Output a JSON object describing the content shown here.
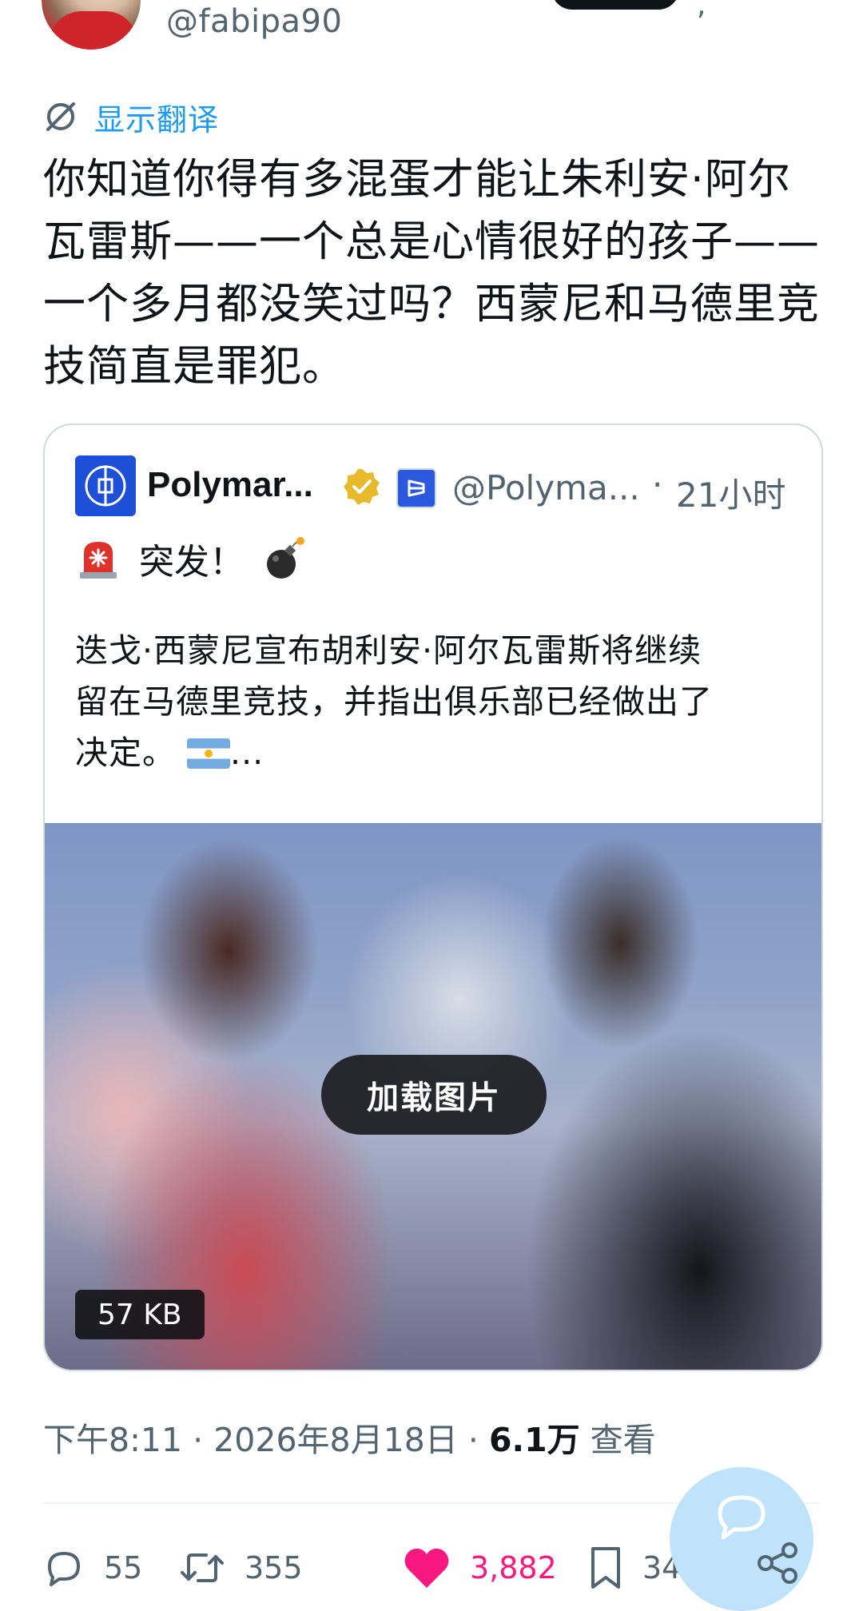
{
  "author": {
    "handle": "@fabipa90"
  },
  "translate": {
    "label": "显示翻译"
  },
  "tweet": {
    "lines": [
      "你知道你得有多混蛋才能让朱利安·阿尔",
      "瓦雷斯——一个总是心情很好的孩子——",
      "一个多月都没笑过吗？西蒙尼和马德里竞",
      "技简直是罪犯。"
    ]
  },
  "quote": {
    "name": "Polymar...",
    "handle": "@Polyma...",
    "separator": "·",
    "time": "21小时",
    "line1": "突发！",
    "body_lines": [
      "迭戈·西蒙尼宣布胡利安·阿尔瓦雷斯将继续",
      "留在马德里竞技，并指出俱乐部已经做出了",
      "决定。"
    ],
    "ellipsis": "...",
    "media": {
      "load_label": "加载图片",
      "size": "57 KB"
    }
  },
  "meta": {
    "time": "下午8:11",
    "date": "2026年8月18日",
    "separator": "·",
    "views_count": "6.1万",
    "views_label": "查看"
  },
  "actions": {
    "replies": "55",
    "retweets": "355",
    "likes": "3,882",
    "bookmarks": "34",
    "like_color": "#f91880"
  },
  "icons": {
    "translate": "no-translate-icon",
    "verified": "gold-verified-badge-icon",
    "siren": "rotating-light-emoji",
    "bomb": "bomb-emoji",
    "flag": "argentina-flag-emoji",
    "reply": "reply-bubble-icon",
    "retweet": "retweet-icon",
    "like": "heart-icon",
    "bookmark": "bookmark-icon",
    "share": "share-icon",
    "fab": "compose-reply-icon"
  },
  "colors": {
    "accent": "#1d9bf0",
    "text": "#0f1419",
    "secondary": "#536471"
  }
}
